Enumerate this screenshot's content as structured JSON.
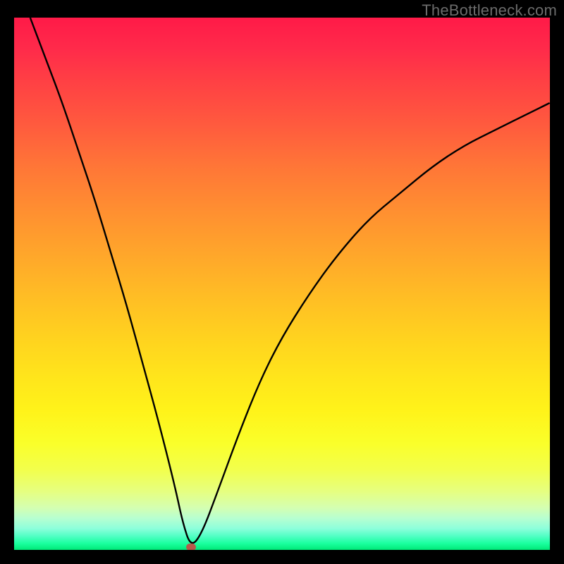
{
  "watermark": "TheBottleneck.com",
  "chart_data": {
    "type": "line",
    "title": "",
    "xlabel": "",
    "ylabel": "",
    "xlim": [
      0,
      100
    ],
    "ylim": [
      0,
      100
    ],
    "grid": false,
    "legend": false,
    "background": "vertical-gradient red→yellow→green",
    "series": [
      {
        "name": "bottleneck-curve",
        "x": [
          3,
          6,
          9,
          12,
          15,
          18,
          21,
          24,
          27,
          30,
          31.5,
          33,
          35,
          38,
          42,
          46,
          50,
          55,
          60,
          66,
          72,
          78,
          84,
          90,
          96,
          100
        ],
        "y": [
          100,
          92,
          84,
          75,
          66,
          56,
          46,
          35,
          24,
          12,
          5,
          0.5,
          3,
          11,
          22,
          32,
          40,
          48,
          55,
          62,
          67,
          72,
          76,
          79,
          82,
          84
        ]
      }
    ],
    "markers": [
      {
        "name": "optimal-point",
        "x": 33,
        "y": 0.5,
        "color": "#b75a4a"
      }
    ]
  }
}
